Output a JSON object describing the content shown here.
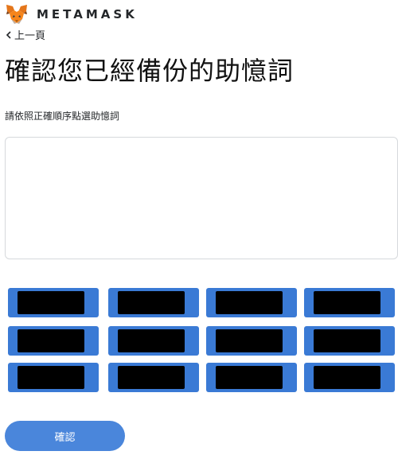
{
  "header": {
    "brand": "METAMASK",
    "logo_icon": "metamask-fox-icon"
  },
  "nav": {
    "back_label": "上一頁",
    "back_icon": "chevron-left-icon"
  },
  "main": {
    "title": "確認您已經備份的助憶詞",
    "instruction": "請依照正確順序點選助憶詞",
    "drop_area": {
      "selected_words": []
    },
    "word_buttons": {
      "count": 12,
      "rows": 3,
      "columns": 4,
      "content": "redacted",
      "button_color": "#3a7ad5",
      "redaction_color": "#000000"
    },
    "confirm_label": "確認"
  },
  "colors": {
    "accent": "#4a86db",
    "text": "#24272a",
    "border": "#d6d9dc"
  }
}
